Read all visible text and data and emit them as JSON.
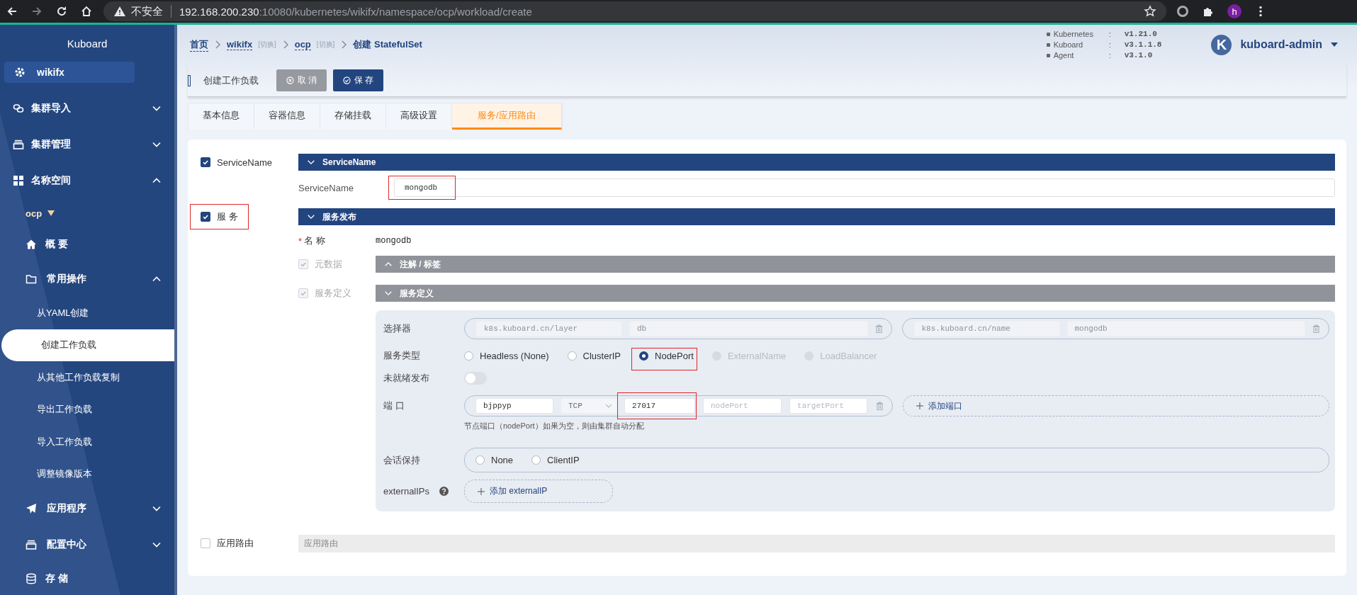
{
  "browser": {
    "security_label": "不安全",
    "url_host": "192.168.200.230",
    "url_rest": ":10080/kubernetes/wikifx/namespace/ocp/workload/create",
    "profile_initial": "h"
  },
  "sidebar": {
    "title": "Kuboard",
    "items": [
      {
        "kind": "cluster",
        "label": "wikifx"
      },
      {
        "kind": "group",
        "label": "集群导入",
        "expanded": false
      },
      {
        "kind": "group",
        "label": "集群管理",
        "expanded": false
      },
      {
        "kind": "group",
        "label": "名称空间",
        "expanded": true,
        "children": [
          {
            "kind": "namespace",
            "label": "ocp"
          },
          {
            "kind": "item",
            "label": "概 要"
          },
          {
            "kind": "group",
            "label": "常用操作",
            "expanded": true,
            "children": [
              {
                "kind": "leaf",
                "label": "从YAML创建",
                "selected": false
              },
              {
                "kind": "leaf",
                "label": "创建工作负载",
                "selected": true
              },
              {
                "kind": "leaf",
                "label": "从其他工作负载复制",
                "selected": false
              },
              {
                "kind": "leaf",
                "label": "导出工作负载",
                "selected": false
              },
              {
                "kind": "leaf",
                "label": "导入工作负载",
                "selected": false
              },
              {
                "kind": "leaf",
                "label": "调整镜像版本",
                "selected": false
              }
            ]
          },
          {
            "kind": "group",
            "label": "应用程序",
            "expanded": false
          },
          {
            "kind": "group",
            "label": "配置中心",
            "expanded": false
          },
          {
            "kind": "item",
            "label": "存 储"
          }
        ]
      }
    ]
  },
  "header": {
    "breadcrumb": [
      {
        "kind": "link",
        "label": "首页"
      },
      {
        "kind": "link",
        "label": "wikifx",
        "switch": "[切换]"
      },
      {
        "kind": "link",
        "label": "ocp",
        "switch": "[切换]"
      },
      {
        "kind": "current",
        "label": "创建 StatefulSet"
      }
    ],
    "versions": [
      {
        "name": "Kubernetes",
        "sep": ":",
        "value": "v1.21.0"
      },
      {
        "name": "Kuboard",
        "sep": ":",
        "value": "v3.1.1.8"
      },
      {
        "name": "Agent",
        "sep": ":",
        "value": "v3.1.0"
      }
    ],
    "user": {
      "initial": "K",
      "name": "kuboard-admin"
    }
  },
  "toolbar": {
    "title": "创建工作负载",
    "buttons": [
      {
        "kind": "cancel",
        "label": "取 消"
      },
      {
        "kind": "save",
        "label": "保 存"
      }
    ]
  },
  "tabs": [
    {
      "label": "基本信息",
      "selected": false
    },
    {
      "label": "容器信息",
      "selected": false
    },
    {
      "label": "存储挂载",
      "selected": false
    },
    {
      "label": "高级设置",
      "selected": false
    },
    {
      "label": "服务/应用路由",
      "selected": true
    }
  ],
  "form": {
    "service_name": {
      "checkbox": {
        "label": "ServiceName",
        "checked": true
      },
      "header": "ServiceName",
      "expanded": true,
      "field_label": "ServiceName",
      "value": "mongodb",
      "highlighted": true
    },
    "service": {
      "checkbox": {
        "label": "服 务",
        "checked": true,
        "highlighted": true
      },
      "header": "服务发布",
      "expanded": true,
      "required_mark": "*",
      "name_label": "名 称",
      "name_value": "mongodb",
      "subsections": [
        {
          "label": "元数据",
          "checked": true,
          "header": "注解 / 标签",
          "expanded": false
        },
        {
          "label": "服务定义",
          "checked": true,
          "header": "服务定义",
          "expanded": true
        }
      ],
      "definition": {
        "selector_label": "选择器",
        "selectors": [
          {
            "key": "k8s.kuboard.cn/layer",
            "value": "db",
            "disabled": true
          },
          {
            "key": "k8s.kuboard.cn/name",
            "value": "mongodb",
            "disabled": true
          }
        ],
        "type_label": "服务类型",
        "types": [
          {
            "label": "Headless (None)",
            "selected": false,
            "disabled": false
          },
          {
            "label": "ClusterIP",
            "selected": false,
            "disabled": false
          },
          {
            "label": "NodePort",
            "selected": true,
            "disabled": false,
            "highlighted": true
          },
          {
            "label": "ExternalName",
            "selected": false,
            "disabled": true
          },
          {
            "label": "LoadBalancer",
            "selected": false,
            "disabled": true
          }
        ],
        "unready_label": "未就绪发布",
        "unready_on": false,
        "ports_label": "端 口",
        "ports": [
          {
            "name": "bjppyp",
            "protocol": "TCP",
            "port": "27017",
            "port_highlighted": true,
            "node_port_placeholder": "nodePort",
            "target_port_placeholder": "targetPort"
          }
        ],
        "add_port": "添加端口",
        "ports_hint": "节点端口（nodePort）如果为空，则由集群自动分配",
        "affinity_label": "会话保持",
        "affinity": [
          {
            "label": "None",
            "selected": false
          },
          {
            "label": "ClientIP",
            "selected": false
          }
        ],
        "external_label": "externalIPs",
        "add_external": "添加 externalIP"
      }
    },
    "ingress": {
      "checkbox": {
        "label": "应用路由",
        "checked": false
      },
      "header": "应用路由"
    }
  }
}
